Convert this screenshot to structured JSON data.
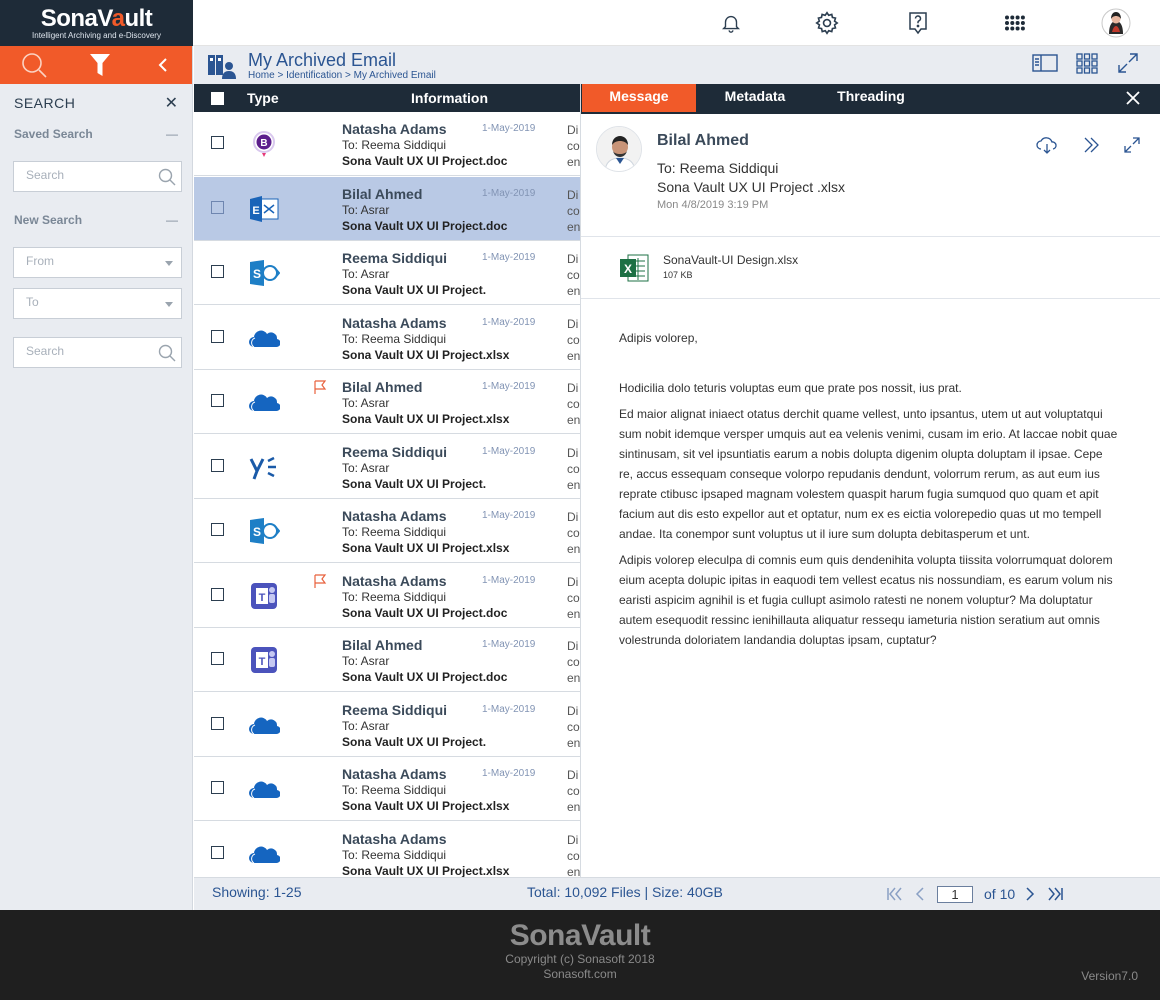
{
  "brand": {
    "name_prefix": "SonaV",
    "name_lock": "a",
    "name_suffix": "ult",
    "tagline": "Intelligent Archiving and e-Discovery",
    "accent_color": "#f15a29",
    "dark_color": "#1e2b38"
  },
  "topbar": {
    "icons": [
      "bell-icon",
      "gear-icon",
      "help-icon",
      "apps-grid-icon",
      "user-avatar"
    ]
  },
  "sidebar": {
    "search_title": "SEARCH",
    "saved_search": {
      "label": "Saved Search",
      "placeholder": "Search"
    },
    "new_search": {
      "label": "New Search",
      "from_placeholder": "From",
      "to_placeholder": "To",
      "search_placeholder": "Search"
    }
  },
  "header": {
    "title": "My Archived Email",
    "breadcrumb": "Home > Identification > My Archived Email"
  },
  "list": {
    "columns": {
      "type": "Type",
      "information": "Information"
    },
    "rows": [
      {
        "type": "bookings",
        "sender": "Natasha Adams",
        "date": "1-May-2019",
        "to": "To: Reema Siddiqui",
        "subject": "Sona Vault UX UI Project.doc",
        "snippet": "Di co en",
        "flag": false,
        "selected": false
      },
      {
        "type": "exchange",
        "sender": "Bilal Ahmed",
        "date": "1-May-2019",
        "to": "To: Asrar",
        "subject": "Sona Vault UX UI Project.doc",
        "snippet": "Di co en",
        "flag": false,
        "selected": true
      },
      {
        "type": "sharepoint",
        "sender": "Reema Siddiqui",
        "date": "1-May-2019",
        "to": "To: Asrar",
        "subject": "Sona Vault UX UI Project.",
        "snippet": "Di co en",
        "flag": false,
        "selected": false
      },
      {
        "type": "onedrive",
        "sender": "Natasha Adams",
        "date": "1-May-2019",
        "to": "To: Reema Siddiqui",
        "subject": "Sona Vault UX UI Project.xlsx",
        "snippet": "Di co en",
        "flag": false,
        "selected": false
      },
      {
        "type": "onedrive",
        "sender": "Bilal Ahmed",
        "date": "1-May-2019",
        "to": "To: Asrar",
        "subject": "Sona Vault UX UI Project.xlsx",
        "snippet": "Di co en",
        "flag": true,
        "selected": false
      },
      {
        "type": "yammer",
        "sender": "Reema Siddiqui",
        "date": "1-May-2019",
        "to": "To: Asrar",
        "subject": "Sona Vault UX UI Project.",
        "snippet": "Di co en",
        "flag": false,
        "selected": false
      },
      {
        "type": "sharepoint",
        "sender": "Natasha Adams",
        "date": "1-May-2019",
        "to": "To: Reema Siddiqui",
        "subject": "Sona Vault UX UI Project.xlsx",
        "snippet": "Di co en",
        "flag": false,
        "selected": false
      },
      {
        "type": "teams",
        "sender": "Natasha Adams",
        "date": "1-May-2019",
        "to": "To: Reema Siddiqui",
        "subject": "Sona Vault UX UI Project.doc",
        "snippet": "Di co en",
        "flag": true,
        "selected": false
      },
      {
        "type": "teams",
        "sender": "Bilal Ahmed",
        "date": "1-May-2019",
        "to": "To: Asrar",
        "subject": "Sona Vault UX UI Project.doc",
        "snippet": "Di co en",
        "flag": false,
        "selected": false
      },
      {
        "type": "onedrive",
        "sender": "Reema Siddiqui",
        "date": "1-May-2019",
        "to": "To: Asrar",
        "subject": "Sona Vault UX UI Project.",
        "snippet": "Di co en",
        "flag": false,
        "selected": false
      },
      {
        "type": "onedrive",
        "sender": "Natasha Adams",
        "date": "1-May-2019",
        "to": "To: Reema Siddiqui",
        "subject": "Sona Vault UX UI Project.xlsx",
        "snippet": "Di co en",
        "flag": false,
        "selected": false
      },
      {
        "type": "onedrive",
        "sender": "Natasha Adams",
        "date": "",
        "to": "To: Reema Siddiqui",
        "subject": "Sona Vault UX UI Project.xlsx",
        "snippet": "Di co en",
        "flag": false,
        "selected": false
      }
    ]
  },
  "pane": {
    "tabs": [
      "Message",
      "Metadata",
      "Threading"
    ],
    "active_tab": "Message",
    "message": {
      "from": "Bilal Ahmed",
      "to": "To: Reema Siddiqui",
      "subject": "Sona Vault UX UI Project .xlsx",
      "date": "Mon 4/8/2019 3:19 PM",
      "attachment": {
        "name": "SonaVault-UI Design.xlsx",
        "size": "107 KB"
      },
      "greeting": "Adipis volorep,",
      "paragraphs": [
        "Hodicilia dolo teturis voluptas eum que prate pos nossit, ius prat.",
        "Ed maior alignat iniaect otatus derchit quame vellest, unto ipsantus, utem ut aut voluptatqui sum nobit idemque versper umquis aut ea velenis venimi, cusam im erio. At laccae nobit quae sintinusam, sit vel ipsuntiatis earum a nobis dolupta digenim olupta doluptam il ipsae. Cepe re, accus essequam conseque volorpo repudanis dendunt, volorrum rerum, as aut eum ius reprate ctibusc ipsaped magnam volestem quaspit harum fugia sumquod quo quam et apit facium aut dis esto expellor aut et optatur, num ex es eictia volorepedio quas ut mo tempell andae. Ita conempor sunt voluptus ut il iure sum dolupta debitasperum et unt.",
        "Adipis volorep eleculpa di comnis eum quis dendenihita volupta tiissita volorrumquat dolorem eium acepta dolupic ipitas in eaquodi tem vellest ecatus nis nossundiam, es earum volum nis earisti aspicim agnihil is et fugia cullupt asimolo ratesti ne nonem voluptur? Ma doluptatur autem esequodit ressinc ienihillauta aliquatur ressequ iameturia nistion seratium aut omnis volestrunda doloriatem landandia doluptas ipsam, cuptatur?"
      ]
    }
  },
  "statusbar": {
    "showing": "Showing:  1-25",
    "total": "Total: 10,092 Files |  Size: 40GB",
    "page": "1",
    "of_pages": "of 10"
  },
  "footer": {
    "copyright": "Copyright (c) Sonasoft 2018",
    "site": "Sonasoft.com",
    "version": "Version7.0"
  }
}
